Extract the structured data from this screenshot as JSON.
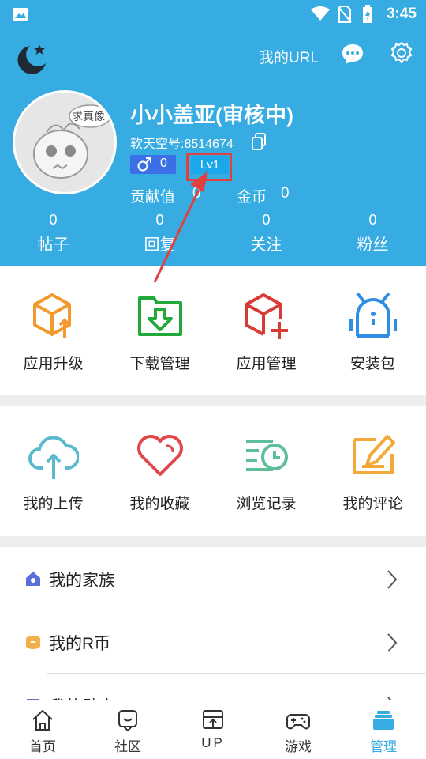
{
  "status_bar": {
    "time": "3:45"
  },
  "header": {
    "url_label": "我的URL",
    "avatar_text": "求真像",
    "username": "小小盖亚(审核中)",
    "uid_text": "软天空号:8514674",
    "gender_count": "0",
    "level": "Lv1",
    "contribution_label": "贡献值",
    "contribution_value": "0",
    "coins_label": "金币",
    "coins_value": "0"
  },
  "stats": [
    {
      "value": "0",
      "label": "帖子"
    },
    {
      "value": "0",
      "label": "回复"
    },
    {
      "value": "0",
      "label": "关注"
    },
    {
      "value": "0",
      "label": "粉丝"
    }
  ],
  "grid1": [
    {
      "label": "应用升级",
      "icon": "upgrade-icon",
      "color": "#f39a2e"
    },
    {
      "label": "下载管理",
      "icon": "download-icon",
      "color": "#22a93a"
    },
    {
      "label": "应用管理",
      "icon": "app-manage-icon",
      "color": "#d83a36"
    },
    {
      "label": "安装包",
      "icon": "android-icon",
      "color": "#2f8ee3"
    }
  ],
  "grid2": [
    {
      "label": "我的上传",
      "icon": "cloud-upload-icon",
      "color": "#5ab9cf"
    },
    {
      "label": "我的收藏",
      "icon": "heart-icon",
      "color": "#e0494b"
    },
    {
      "label": "浏览记录",
      "icon": "history-icon",
      "color": "#5cbf9a"
    },
    {
      "label": "我的评论",
      "icon": "comment-edit-icon",
      "color": "#f3a93a"
    }
  ],
  "list": [
    {
      "label": "我的家族",
      "icon": "family-icon"
    },
    {
      "label": "我的R币",
      "icon": "coin-icon"
    },
    {
      "label": "我的勋章",
      "icon": "medal-icon"
    }
  ],
  "tabs": [
    {
      "label": "首页",
      "icon": "home-icon"
    },
    {
      "label": "社区",
      "icon": "community-icon"
    },
    {
      "label": "UP",
      "icon": "up-icon"
    },
    {
      "label": "游戏",
      "icon": "gamepad-icon"
    },
    {
      "label": "管理",
      "icon": "manage-icon",
      "active": true
    }
  ],
  "colors": {
    "header_bg": "#36ace2",
    "level_box": "#e0413f",
    "active_tab": "#36ace2"
  }
}
